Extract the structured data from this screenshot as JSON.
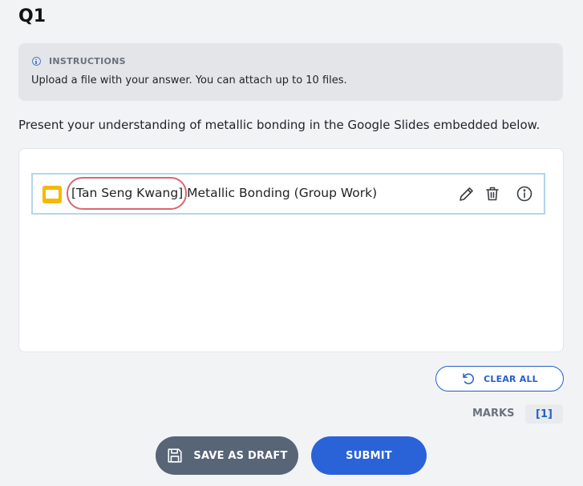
{
  "question": {
    "number": "Q1",
    "prompt": "Present your understanding of metallic bonding in the Google Slides embedded below."
  },
  "instructions": {
    "icon": "info-icon",
    "label": "INSTRUCTIONS",
    "text": "Upload a file with your answer. You can attach up to 10 files."
  },
  "attachments": [
    {
      "icon": "google-slides-icon",
      "name_prefix": "[Tan Seng Kwang]",
      "name_rest": " Metallic Bonding (Group Work)",
      "actions": [
        "edit-icon",
        "trash-icon",
        "info-icon"
      ]
    }
  ],
  "clear_all": {
    "icon": "undo-icon",
    "label": "CLEAR ALL"
  },
  "marks": {
    "label": "MARKS",
    "value": "[1]"
  },
  "footer": {
    "draft": {
      "icon": "save-icon",
      "label": "SAVE AS DRAFT"
    },
    "submit": {
      "label": "SUBMIT"
    }
  },
  "colors": {
    "accent": "#2a63d7",
    "draft_button": "#576577",
    "slides_icon": "#f5b800",
    "highlight": "#d9676f"
  }
}
